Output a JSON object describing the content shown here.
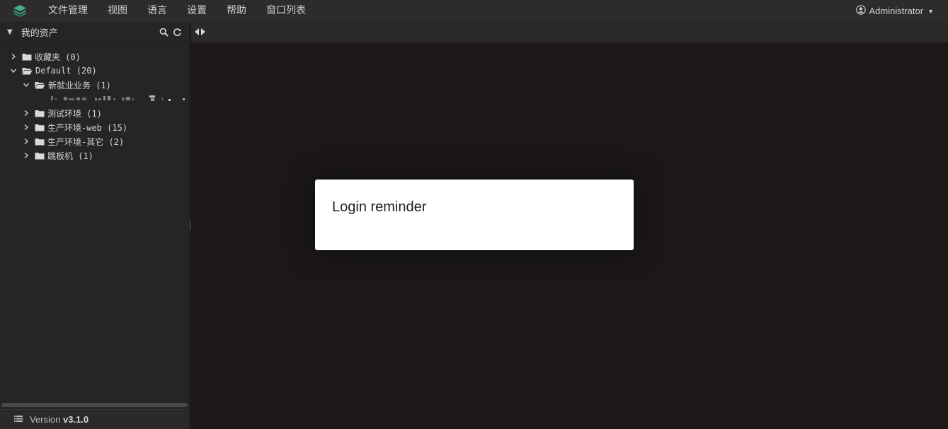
{
  "menubar": {
    "items": [
      "文件管理",
      "视图",
      "语言",
      "设置",
      "帮助",
      "窗口列表"
    ],
    "user": "Administrator"
  },
  "sidebar": {
    "title": "我的资产",
    "tree": [
      {
        "label": "收藏夹 (0)",
        "expanded": false
      },
      {
        "label": "Default (20)",
        "expanded": true
      },
      {
        "label": "新就业业务 (1)",
        "expanded": true
      },
      {
        "label": "测试环境 (1)",
        "expanded": false
      },
      {
        "label": "生产环境-web (15)",
        "expanded": false
      },
      {
        "label": "生产环境-其它 (2)",
        "expanded": false
      },
      {
        "label": "跳板机 (1)",
        "expanded": false
      }
    ],
    "version_label": "Version",
    "version_value": "v3.1.0"
  },
  "modal": {
    "title": "Login reminder"
  },
  "colors": {
    "logo_accent": "#3fae8a",
    "menubar_bg": "#2e2b2b",
    "sidebar_bg": "#272424",
    "main_bg": "#1c1818"
  }
}
